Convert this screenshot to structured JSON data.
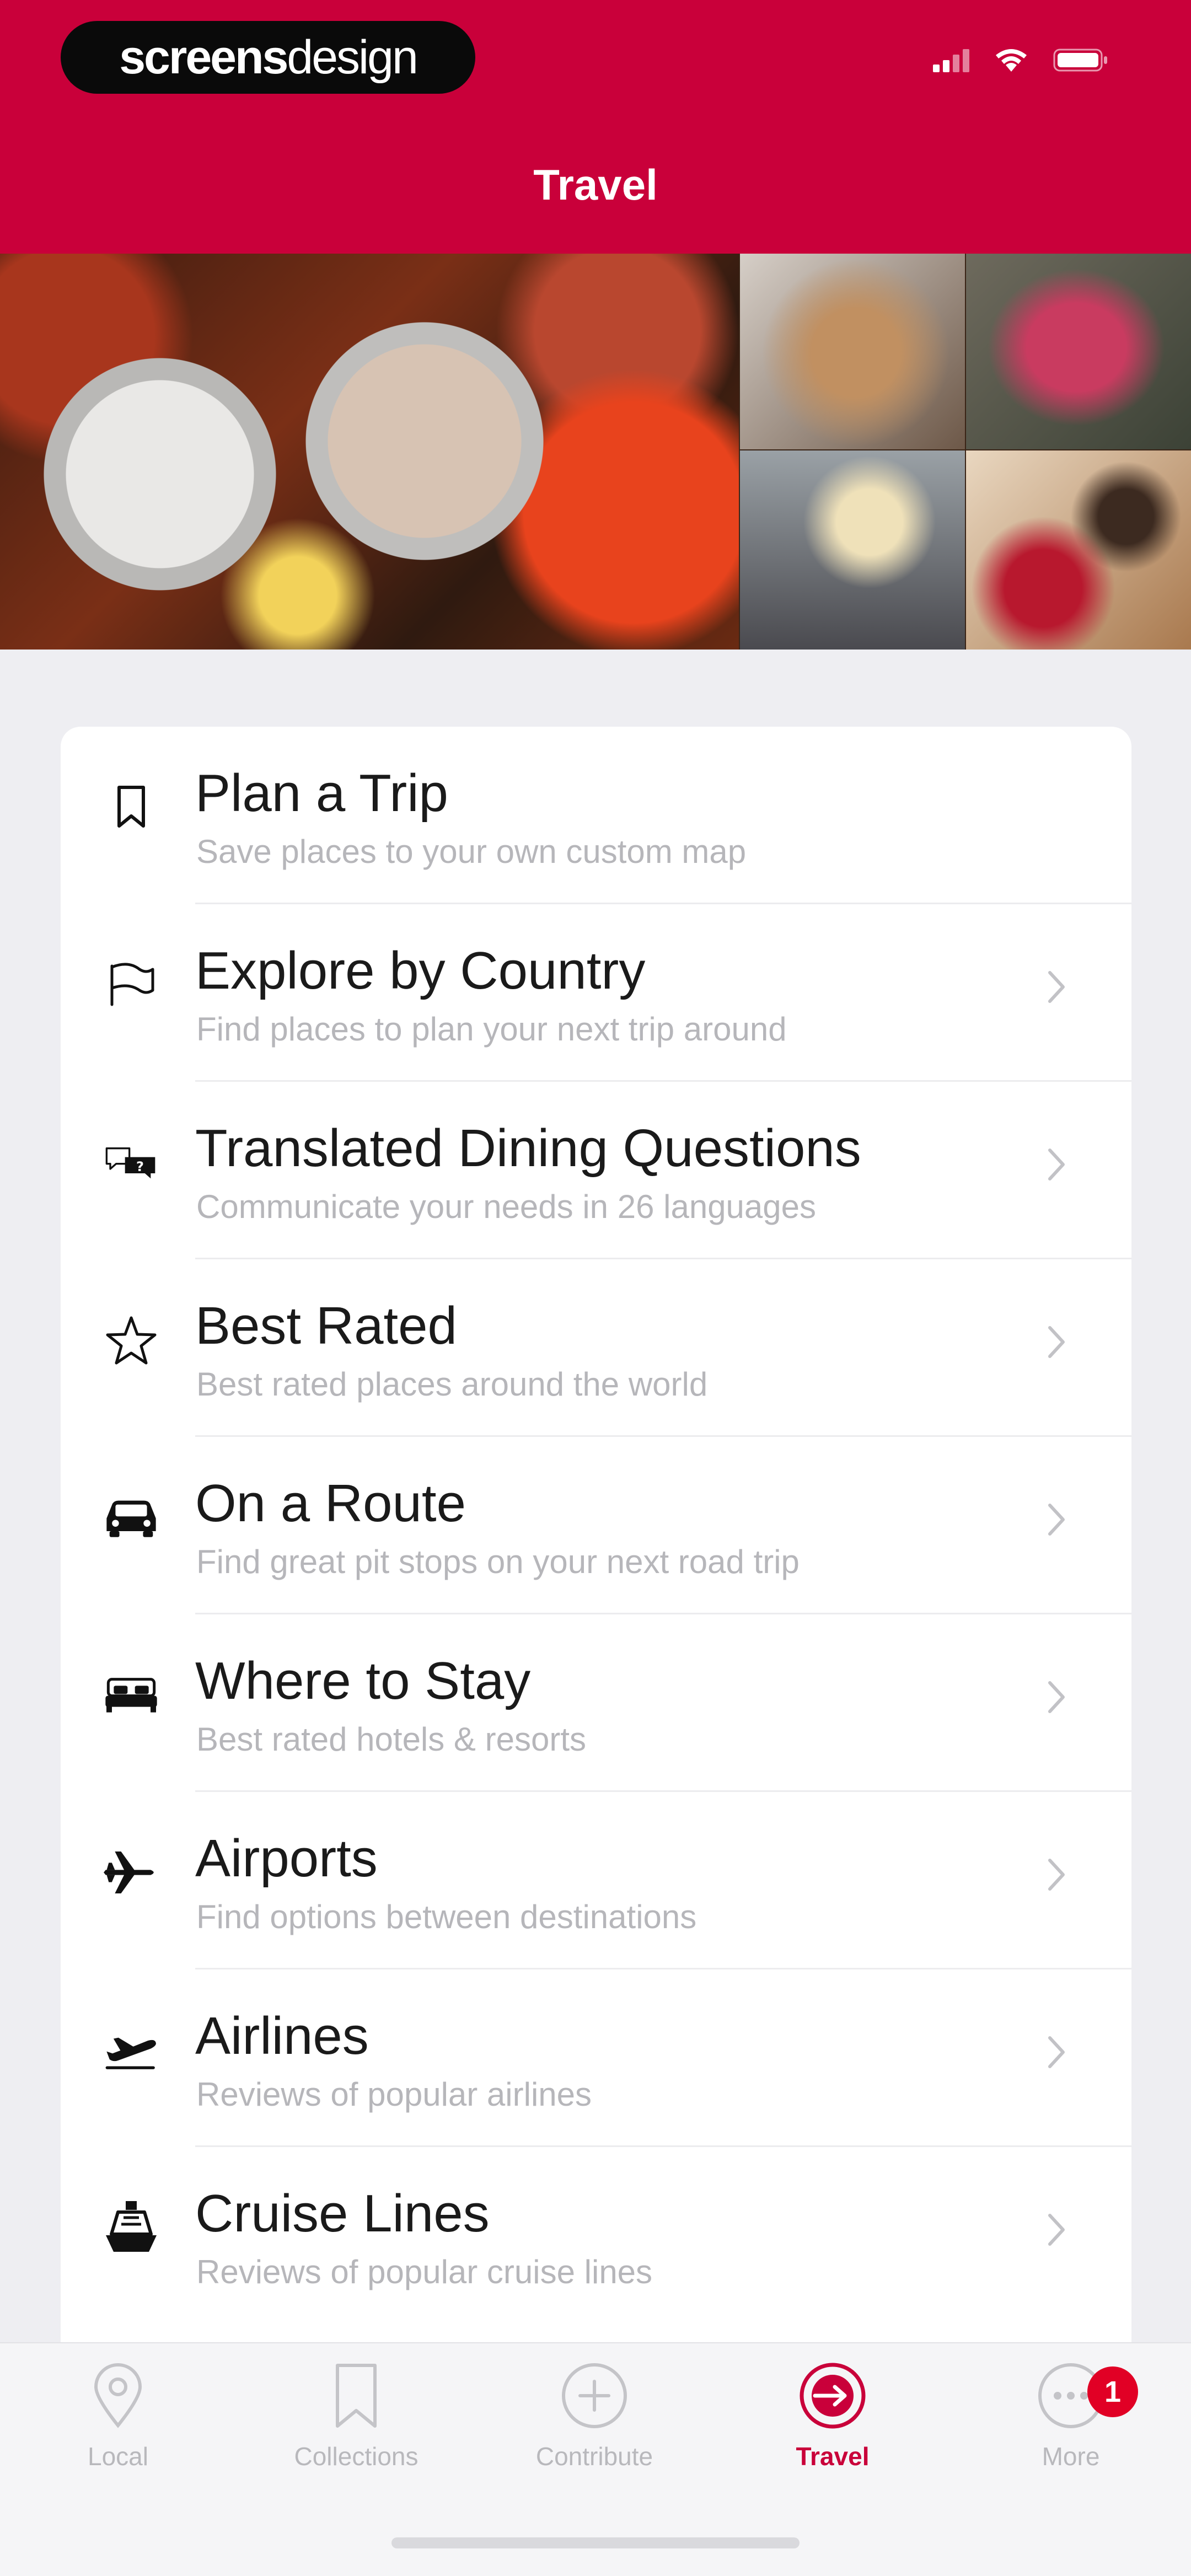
{
  "status_bar": {
    "brand_part1": "screens",
    "brand_part2": "design",
    "icons": [
      "signal-icon",
      "wifi-icon",
      "battery-icon"
    ]
  },
  "header": {
    "title": "Travel",
    "background": "#c9003a"
  },
  "menu": {
    "items": [
      {
        "title": "Plan a Trip",
        "subtitle": "Save places to your own custom map",
        "icon": "bookmark-icon",
        "has_chevron": false
      },
      {
        "title": "Explore by Country",
        "subtitle": "Find places to plan your next trip around",
        "icon": "flag-icon",
        "has_chevron": true
      },
      {
        "title": "Translated Dining Questions",
        "subtitle": "Communicate your needs in 26 languages",
        "icon": "translate-chat-icon",
        "has_chevron": true
      },
      {
        "title": "Best Rated",
        "subtitle": "Best rated places around the world",
        "icon": "star-icon",
        "has_chevron": true
      },
      {
        "title": "On a Route",
        "subtitle": "Find great pit stops on your next road trip",
        "icon": "car-icon",
        "has_chevron": true
      },
      {
        "title": "Where to Stay",
        "subtitle": "Best rated hotels & resorts",
        "icon": "bed-icon",
        "has_chevron": true
      },
      {
        "title": "Airports",
        "subtitle": "Find options between destinations",
        "icon": "airplane-icon",
        "has_chevron": true
      },
      {
        "title": "Airlines",
        "subtitle": "Reviews of popular airlines",
        "icon": "airplane-takeoff-icon",
        "has_chevron": true
      },
      {
        "title": "Cruise Lines",
        "subtitle": "Reviews of popular cruise lines",
        "icon": "ship-icon",
        "has_chevron": true
      }
    ]
  },
  "tabbar": {
    "tabs": [
      {
        "label": "Local",
        "icon": "location-pin-icon",
        "active": false
      },
      {
        "label": "Collections",
        "icon": "bookmark-icon",
        "active": false
      },
      {
        "label": "Contribute",
        "icon": "plus-circle-icon",
        "active": false
      },
      {
        "label": "Travel",
        "icon": "travel-arrow-icon",
        "active": true
      },
      {
        "label": "More",
        "icon": "more-icon",
        "active": false,
        "badge": "1"
      }
    ],
    "active_color": "#c9003a"
  }
}
